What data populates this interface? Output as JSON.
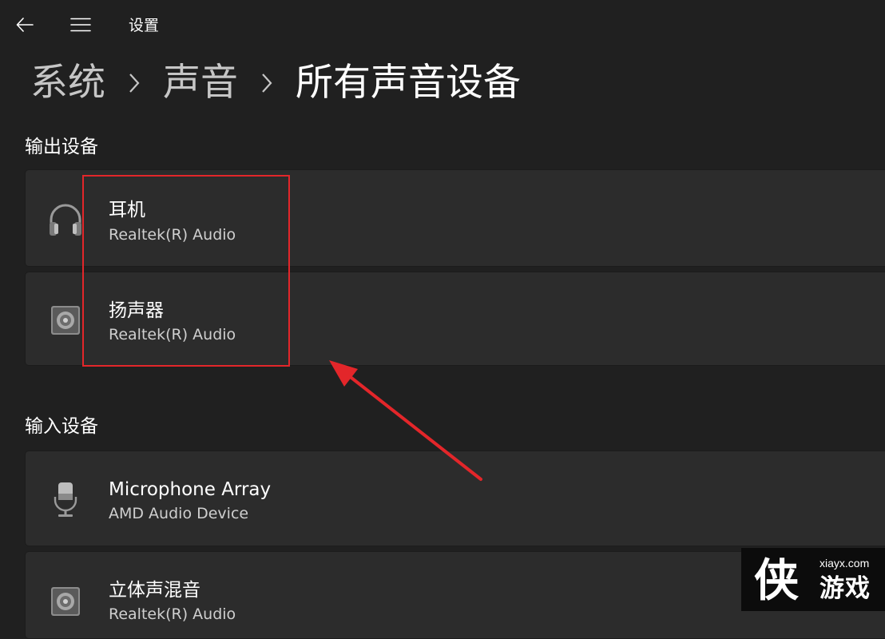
{
  "header": {
    "app_title": "设置",
    "back_icon": "back-arrow-icon",
    "menu_icon": "hamburger-menu-icon"
  },
  "breadcrumb": {
    "items": [
      "系统",
      "声音",
      "所有声音设备"
    ],
    "separator": "›"
  },
  "output_section": {
    "title": "输出设备",
    "devices": [
      {
        "name": "耳机",
        "sub": "Realtek(R) Audio",
        "icon": "headphones-icon"
      },
      {
        "name": "扬声器",
        "sub": "Realtek(R) Audio",
        "icon": "speaker-icon"
      }
    ]
  },
  "input_section": {
    "title": "输入设备",
    "devices": [
      {
        "name": "Microphone Array",
        "sub": "AMD Audio Device",
        "icon": "microphone-icon"
      },
      {
        "name": "立体声混音",
        "sub": "Realtek(R) Audio",
        "icon": "speaker-icon"
      }
    ]
  },
  "annotation": {
    "highlight_color": "#e3262a",
    "arrow_color": "#e3262a"
  },
  "watermark": {
    "url": "xiayx.com",
    "name": "游戏",
    "logo_char": "侠"
  },
  "colors": {
    "background": "#202020",
    "card": "#2c2c2c",
    "text_primary": "#ffffff",
    "text_secondary": "#cfcfcf",
    "breadcrumb_muted": "#c6c6c6"
  }
}
